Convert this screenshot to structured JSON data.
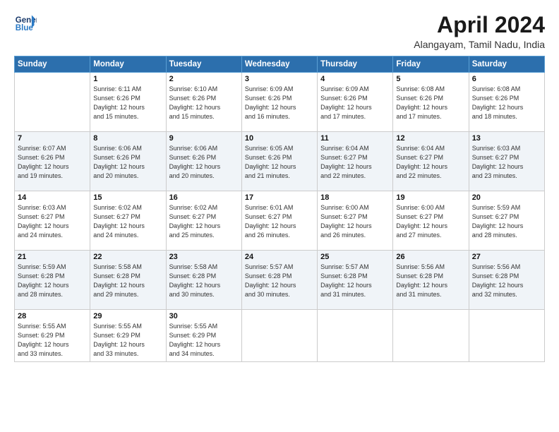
{
  "logo": {
    "line1": "General",
    "line2": "Blue"
  },
  "title": "April 2024",
  "location": "Alangayam, Tamil Nadu, India",
  "days_of_week": [
    "Sunday",
    "Monday",
    "Tuesday",
    "Wednesday",
    "Thursday",
    "Friday",
    "Saturday"
  ],
  "weeks": [
    [
      {
        "day": "",
        "info": ""
      },
      {
        "day": "1",
        "info": "Sunrise: 6:11 AM\nSunset: 6:26 PM\nDaylight: 12 hours\nand 15 minutes."
      },
      {
        "day": "2",
        "info": "Sunrise: 6:10 AM\nSunset: 6:26 PM\nDaylight: 12 hours\nand 15 minutes."
      },
      {
        "day": "3",
        "info": "Sunrise: 6:09 AM\nSunset: 6:26 PM\nDaylight: 12 hours\nand 16 minutes."
      },
      {
        "day": "4",
        "info": "Sunrise: 6:09 AM\nSunset: 6:26 PM\nDaylight: 12 hours\nand 17 minutes."
      },
      {
        "day": "5",
        "info": "Sunrise: 6:08 AM\nSunset: 6:26 PM\nDaylight: 12 hours\nand 17 minutes."
      },
      {
        "day": "6",
        "info": "Sunrise: 6:08 AM\nSunset: 6:26 PM\nDaylight: 12 hours\nand 18 minutes."
      }
    ],
    [
      {
        "day": "7",
        "info": "Sunrise: 6:07 AM\nSunset: 6:26 PM\nDaylight: 12 hours\nand 19 minutes."
      },
      {
        "day": "8",
        "info": "Sunrise: 6:06 AM\nSunset: 6:26 PM\nDaylight: 12 hours\nand 20 minutes."
      },
      {
        "day": "9",
        "info": "Sunrise: 6:06 AM\nSunset: 6:26 PM\nDaylight: 12 hours\nand 20 minutes."
      },
      {
        "day": "10",
        "info": "Sunrise: 6:05 AM\nSunset: 6:26 PM\nDaylight: 12 hours\nand 21 minutes."
      },
      {
        "day": "11",
        "info": "Sunrise: 6:04 AM\nSunset: 6:27 PM\nDaylight: 12 hours\nand 22 minutes."
      },
      {
        "day": "12",
        "info": "Sunrise: 6:04 AM\nSunset: 6:27 PM\nDaylight: 12 hours\nand 22 minutes."
      },
      {
        "day": "13",
        "info": "Sunrise: 6:03 AM\nSunset: 6:27 PM\nDaylight: 12 hours\nand 23 minutes."
      }
    ],
    [
      {
        "day": "14",
        "info": "Sunrise: 6:03 AM\nSunset: 6:27 PM\nDaylight: 12 hours\nand 24 minutes."
      },
      {
        "day": "15",
        "info": "Sunrise: 6:02 AM\nSunset: 6:27 PM\nDaylight: 12 hours\nand 24 minutes."
      },
      {
        "day": "16",
        "info": "Sunrise: 6:02 AM\nSunset: 6:27 PM\nDaylight: 12 hours\nand 25 minutes."
      },
      {
        "day": "17",
        "info": "Sunrise: 6:01 AM\nSunset: 6:27 PM\nDaylight: 12 hours\nand 26 minutes."
      },
      {
        "day": "18",
        "info": "Sunrise: 6:00 AM\nSunset: 6:27 PM\nDaylight: 12 hours\nand 26 minutes."
      },
      {
        "day": "19",
        "info": "Sunrise: 6:00 AM\nSunset: 6:27 PM\nDaylight: 12 hours\nand 27 minutes."
      },
      {
        "day": "20",
        "info": "Sunrise: 5:59 AM\nSunset: 6:27 PM\nDaylight: 12 hours\nand 28 minutes."
      }
    ],
    [
      {
        "day": "21",
        "info": "Sunrise: 5:59 AM\nSunset: 6:28 PM\nDaylight: 12 hours\nand 28 minutes."
      },
      {
        "day": "22",
        "info": "Sunrise: 5:58 AM\nSunset: 6:28 PM\nDaylight: 12 hours\nand 29 minutes."
      },
      {
        "day": "23",
        "info": "Sunrise: 5:58 AM\nSunset: 6:28 PM\nDaylight: 12 hours\nand 30 minutes."
      },
      {
        "day": "24",
        "info": "Sunrise: 5:57 AM\nSunset: 6:28 PM\nDaylight: 12 hours\nand 30 minutes."
      },
      {
        "day": "25",
        "info": "Sunrise: 5:57 AM\nSunset: 6:28 PM\nDaylight: 12 hours\nand 31 minutes."
      },
      {
        "day": "26",
        "info": "Sunrise: 5:56 AM\nSunset: 6:28 PM\nDaylight: 12 hours\nand 31 minutes."
      },
      {
        "day": "27",
        "info": "Sunrise: 5:56 AM\nSunset: 6:28 PM\nDaylight: 12 hours\nand 32 minutes."
      }
    ],
    [
      {
        "day": "28",
        "info": "Sunrise: 5:55 AM\nSunset: 6:29 PM\nDaylight: 12 hours\nand 33 minutes."
      },
      {
        "day": "29",
        "info": "Sunrise: 5:55 AM\nSunset: 6:29 PM\nDaylight: 12 hours\nand 33 minutes."
      },
      {
        "day": "30",
        "info": "Sunrise: 5:55 AM\nSunset: 6:29 PM\nDaylight: 12 hours\nand 34 minutes."
      },
      {
        "day": "",
        "info": ""
      },
      {
        "day": "",
        "info": ""
      },
      {
        "day": "",
        "info": ""
      },
      {
        "day": "",
        "info": ""
      }
    ]
  ]
}
